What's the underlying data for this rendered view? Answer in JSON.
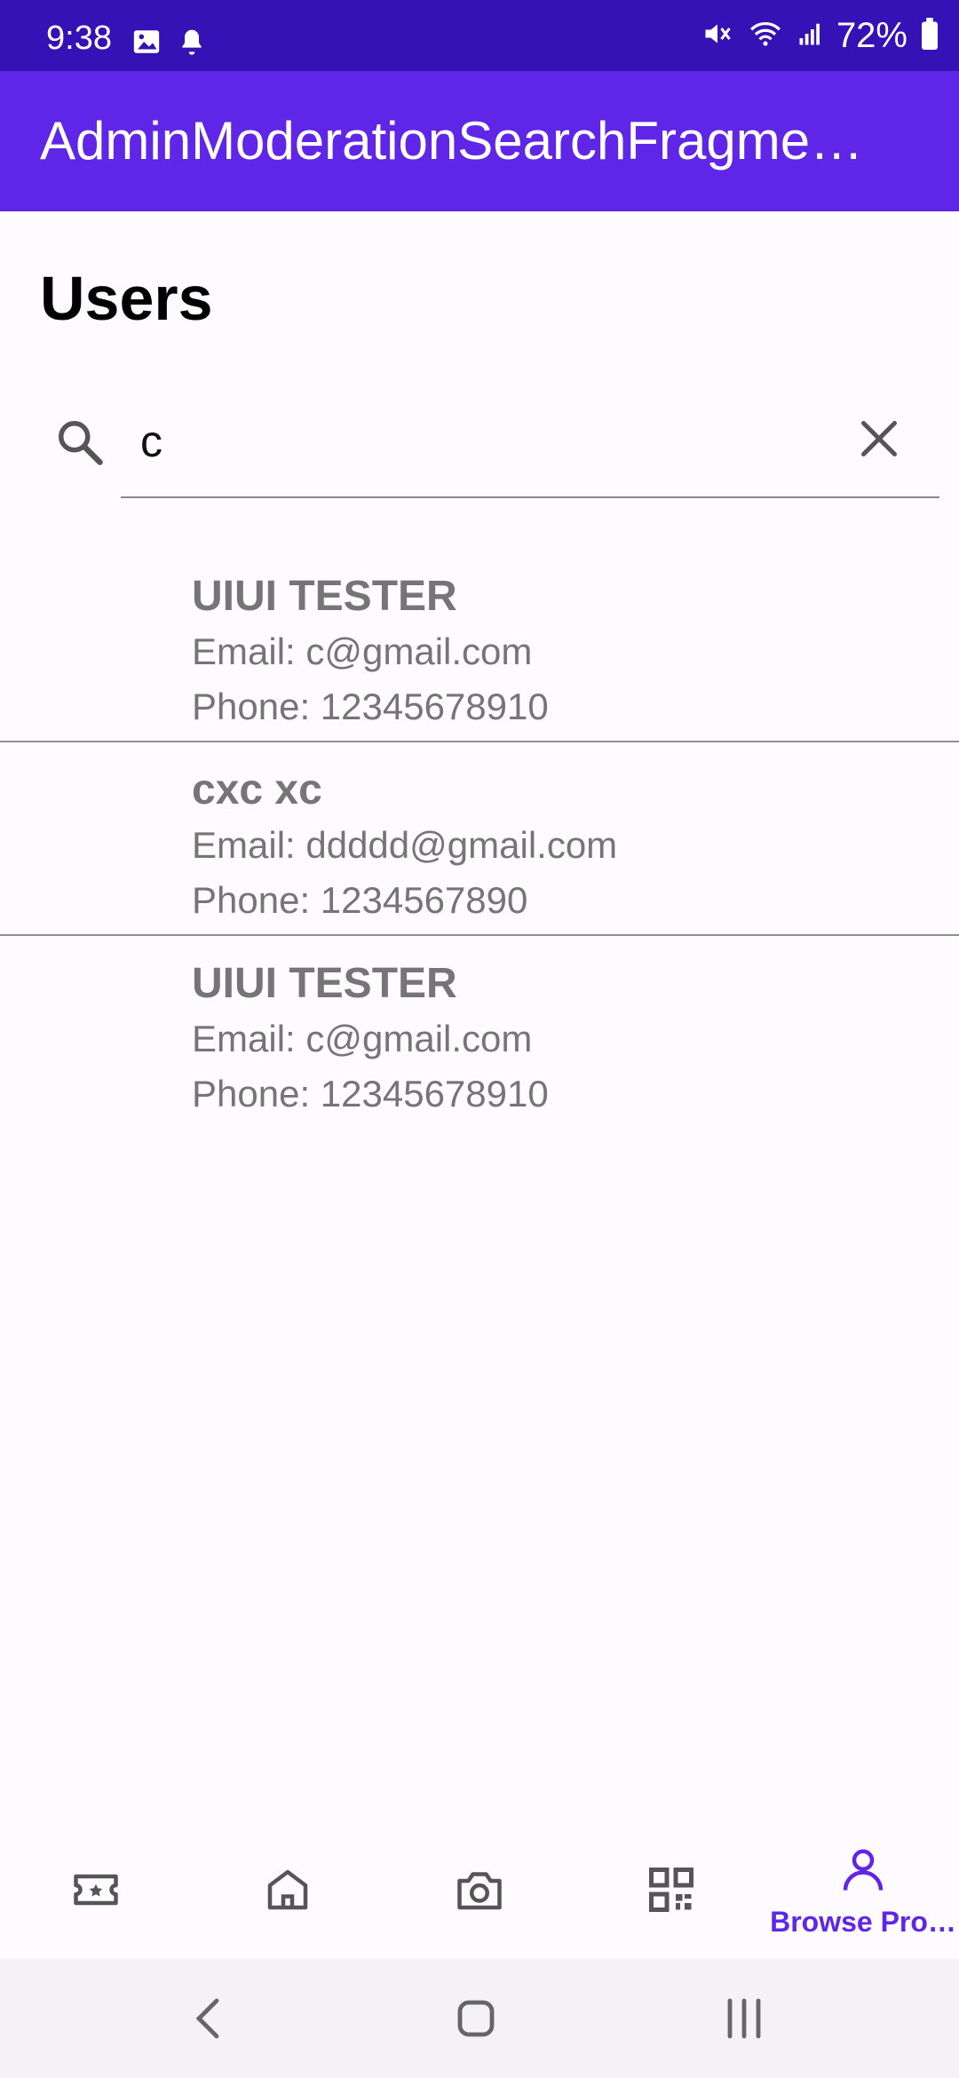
{
  "status_bar": {
    "time": "9:38",
    "battery": "72%",
    "icons": [
      "gallery-icon",
      "notification-bell-icon",
      "mute-icon",
      "wifi-icon",
      "signal-icon",
      "battery-icon"
    ]
  },
  "app_bar": {
    "title": "AdminModerationSearchFragme…"
  },
  "page": {
    "title": "Users"
  },
  "search": {
    "value": "c",
    "icon": "search-icon",
    "clear_icon": "close-icon"
  },
  "users": [
    {
      "name": "UIUI TESTER",
      "email": "Email: c@gmail.com",
      "phone": "Phone: 12345678910"
    },
    {
      "name": "cxc xc",
      "email": "Email: ddddd@gmail.com",
      "phone": "Phone: 1234567890"
    },
    {
      "name": "UIUI TESTER",
      "email": "Email: c@gmail.com",
      "phone": "Phone: 12345678910"
    }
  ],
  "bottom_nav": {
    "items": [
      {
        "icon": "ticket-icon"
      },
      {
        "icon": "home-icon"
      },
      {
        "icon": "camera-icon"
      },
      {
        "icon": "qr-code-icon"
      },
      {
        "icon": "profile-icon",
        "label": "Browse Pro…",
        "active": true
      }
    ]
  },
  "colors": {
    "status_bar": "#3512b5",
    "app_bar": "#5f26e8",
    "accent": "#5f26e8",
    "secondary_text": "#757575"
  }
}
